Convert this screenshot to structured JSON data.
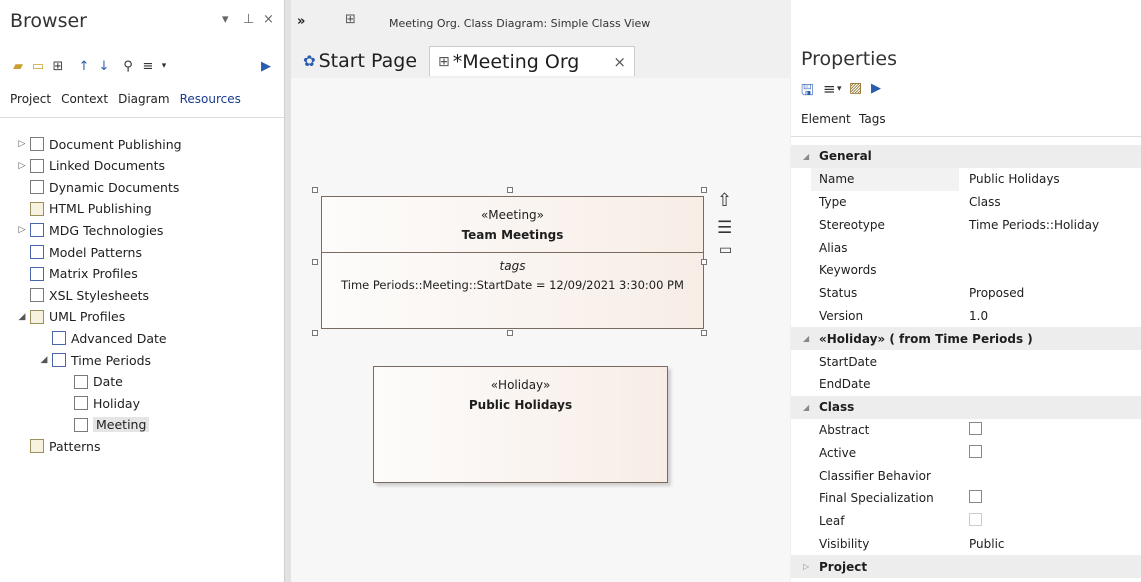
{
  "browser": {
    "title": "Browser",
    "tabs": [
      "Project",
      "Context",
      "Diagram",
      "Resources"
    ],
    "tree": [
      {
        "label": "Document Publishing",
        "indent": 0,
        "exp": "▷",
        "icon": "doc"
      },
      {
        "label": "Linked Documents",
        "indent": 0,
        "exp": "▷",
        "icon": "doc"
      },
      {
        "label": "Dynamic Documents",
        "indent": 0,
        "exp": "",
        "icon": "doc"
      },
      {
        "label": "HTML Publishing",
        "indent": 0,
        "exp": "",
        "icon": "pkg"
      },
      {
        "label": "MDG Technologies",
        "indent": 0,
        "exp": "▷",
        "icon": "prof"
      },
      {
        "label": "Model Patterns",
        "indent": 0,
        "exp": "",
        "icon": "prof"
      },
      {
        "label": "Matrix Profiles",
        "indent": 0,
        "exp": "",
        "icon": "prof"
      },
      {
        "label": "XSL Stylesheets",
        "indent": 0,
        "exp": "",
        "icon": "doc"
      },
      {
        "label": "UML Profiles",
        "indent": 0,
        "exp": "◢",
        "icon": "pkg"
      },
      {
        "label": "Advanced Date",
        "indent": 1,
        "exp": "",
        "icon": "prof"
      },
      {
        "label": "Time Periods",
        "indent": 1,
        "exp": "◢",
        "icon": "prof"
      },
      {
        "label": "Date",
        "indent": 2,
        "exp": "",
        "icon": "doc"
      },
      {
        "label": "Holiday",
        "indent": 2,
        "exp": "",
        "icon": "doc"
      },
      {
        "label": "Meeting",
        "indent": 2,
        "exp": "",
        "icon": "doc",
        "selected": true
      },
      {
        "label": "Patterns",
        "indent": 0,
        "exp": "",
        "icon": "pkg"
      }
    ]
  },
  "center": {
    "breadcrumb": "Meeting Org.  Class Diagram: Simple Class View",
    "tabs": [
      {
        "label": "Start Page"
      },
      {
        "label": "*Meeting Org",
        "close": "×"
      }
    ],
    "classes": {
      "meeting": {
        "stereotype": "«Meeting»",
        "name": "Team Meetings",
        "tags_title": "tags",
        "tag_value": "Time Periods::Meeting::StartDate = 12/09/2021 3:30:00 PM"
      },
      "holiday": {
        "stereotype": "«Holiday»",
        "name": "Public Holidays"
      }
    }
  },
  "properties": {
    "title": "Properties",
    "tabs": [
      "Element",
      "Tags"
    ],
    "rows": [
      {
        "type": "sec",
        "k": "General"
      },
      {
        "k": "Name",
        "v": "Public Holidays",
        "shade": true
      },
      {
        "k": "Type",
        "v": "Class"
      },
      {
        "k": "Stereotype",
        "v": "Time Periods::Holiday"
      },
      {
        "k": "Alias",
        "v": ""
      },
      {
        "k": "Keywords",
        "v": ""
      },
      {
        "k": "Status",
        "v": "Proposed"
      },
      {
        "k": "Version",
        "v": "1.0"
      },
      {
        "type": "sec",
        "k": "«Holiday»  ( from Time Periods )"
      },
      {
        "k": "StartDate",
        "v": ""
      },
      {
        "k": "EndDate",
        "v": ""
      },
      {
        "type": "sec",
        "k": "Class"
      },
      {
        "k": "Abstract",
        "cb": true
      },
      {
        "k": "Active",
        "cb": true
      },
      {
        "k": "Classifier Behavior",
        "v": ""
      },
      {
        "k": "Final Specialization",
        "cb": true
      },
      {
        "k": "Leaf",
        "cb": "disabled"
      },
      {
        "k": "Visibility",
        "v": "Public"
      },
      {
        "type": "sec",
        "k": "Project",
        "collapsed": true
      }
    ]
  }
}
